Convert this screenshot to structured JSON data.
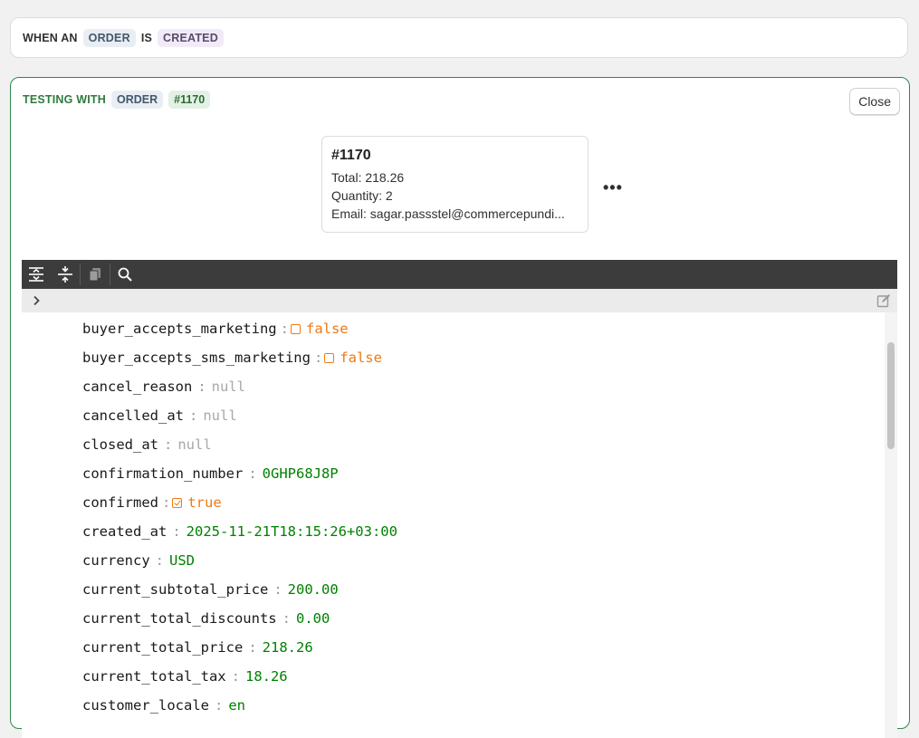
{
  "trigger": {
    "when_an": "WHEN AN",
    "entity": "ORDER",
    "is": "IS",
    "event": "CREATED"
  },
  "testing": {
    "label": "TESTING WITH",
    "entity": "ORDER",
    "order_ref": "#1170",
    "close_label": "Close"
  },
  "order_node": {
    "number": "#1170",
    "total": "Total: 218.26",
    "quantity": "Quantity: 2",
    "email": "Email: sagar.passstel@commercepundi..."
  },
  "more_menu": "•••",
  "json_toolbar": {
    "icons": [
      "expand-all-icon",
      "collapse-all-icon",
      "copy-icon",
      "search-icon"
    ]
  },
  "json_rows": [
    {
      "key": "buyer_accepts_marketing",
      "sep": ":",
      "value": "false",
      "type": "bool",
      "checked": false
    },
    {
      "key": "buyer_accepts_sms_marketing",
      "sep": ":",
      "value": "false",
      "type": "bool",
      "checked": false
    },
    {
      "key": "cancel_reason",
      "sep": ":",
      "value": "null",
      "type": "null"
    },
    {
      "key": "cancelled_at",
      "sep": ":",
      "value": "null",
      "type": "null"
    },
    {
      "key": "closed_at",
      "sep": ":",
      "value": "null",
      "type": "null"
    },
    {
      "key": "confirmation_number",
      "sep": ":",
      "value": "0GHP68J8P",
      "type": "str"
    },
    {
      "key": "confirmed",
      "sep": ":",
      "value": "true",
      "type": "bool",
      "checked": true
    },
    {
      "key": "created_at",
      "sep": ":",
      "value": "2025-11-21T18:15:26+03:00",
      "type": "str"
    },
    {
      "key": "currency",
      "sep": ":",
      "value": "USD",
      "type": "str"
    },
    {
      "key": "current_subtotal_price",
      "sep": ":",
      "value": "200.00",
      "type": "str"
    },
    {
      "key": "current_total_discounts",
      "sep": ":",
      "value": "0.00",
      "type": "str"
    },
    {
      "key": "current_total_price",
      "sep": ":",
      "value": "218.26",
      "type": "str"
    },
    {
      "key": "current_total_tax",
      "sep": ":",
      "value": "18.26",
      "type": "str"
    },
    {
      "key": "customer_locale",
      "sep": ":",
      "value": "en",
      "type": "str"
    }
  ],
  "colors": {
    "accent_green": "#2d8a4e",
    "string_value": "#008000",
    "bool_value": "#ee7a14",
    "null_value": "#a8a8a8",
    "toolbar_bg": "#3c3c3c"
  }
}
